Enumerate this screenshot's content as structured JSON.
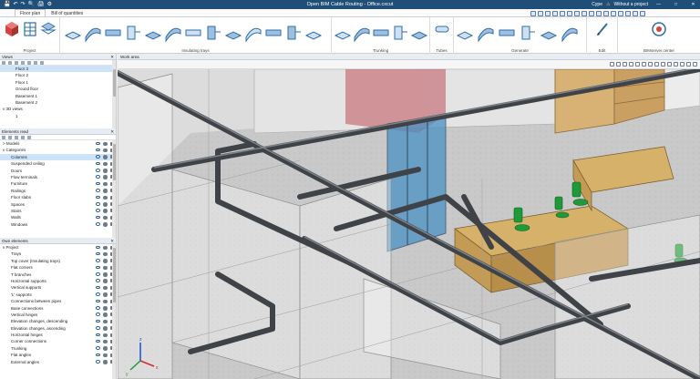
{
  "window": {
    "title": "Open BIM Cable Routing - Office.cxcut",
    "account_label": "Cype",
    "project_status": "Without a project",
    "minimize_glyph": "—",
    "maximize_glyph": "□",
    "close_glyph": "✕"
  },
  "quick_access": [
    "💾",
    "↶",
    "↷",
    "🔍",
    "🖨",
    "⚙"
  ],
  "tabs": [
    {
      "label": "Floor plan",
      "active": true
    },
    {
      "label": "Bill of quantities",
      "active": false
    }
  ],
  "ribbon": {
    "groups": [
      {
        "label": "Project"
      },
      {
        "label": "Insulating trays"
      },
      {
        "label": "Trunking"
      },
      {
        "label": "Tubes"
      },
      {
        "label": "Generate"
      },
      {
        "label": "Edit"
      },
      {
        "label": "BIMserver.center"
      }
    ],
    "icon_colors": {
      "primary": "#2f6ea5",
      "accent": "#d64541",
      "dark": "#3b3b3b"
    }
  },
  "views_panel": {
    "title": "Views",
    "items": [
      {
        "label": "Floor 3",
        "indent": 2,
        "selected": true
      },
      {
        "label": "Floor 2",
        "indent": 2
      },
      {
        "label": "Floor 1",
        "indent": 2
      },
      {
        "label": "Ground floor",
        "indent": 2
      },
      {
        "label": "Basement 1",
        "indent": 2
      },
      {
        "label": "Basement 2",
        "indent": 2
      },
      {
        "label": "3D views",
        "indent": 0,
        "expander": "v"
      },
      {
        "label": "1",
        "indent": 2
      }
    ]
  },
  "elements_read_panel": {
    "title": "Elements read",
    "items": [
      {
        "label": "Models",
        "expander": ">"
      },
      {
        "label": "Categories",
        "expander": "v"
      },
      {
        "label": "Columns",
        "indent": 1,
        "selected": true
      },
      {
        "label": "Suspended ceiling",
        "indent": 1
      },
      {
        "label": "Doors",
        "indent": 1
      },
      {
        "label": "Flow terminals",
        "indent": 1
      },
      {
        "label": "Furniture",
        "indent": 1
      },
      {
        "label": "Railings",
        "indent": 1
      },
      {
        "label": "Floor slabs",
        "indent": 1
      },
      {
        "label": "Spaces",
        "indent": 1
      },
      {
        "label": "Stairs",
        "indent": 1
      },
      {
        "label": "Walls",
        "indent": 1
      },
      {
        "label": "Windows",
        "indent": 1
      }
    ]
  },
  "own_elements_panel": {
    "title": "Own elements",
    "items": [
      {
        "label": "Project",
        "expander": "v"
      },
      {
        "label": "Trays",
        "indent": 1
      },
      {
        "label": "Top cover (Insulating trays)",
        "indent": 1
      },
      {
        "label": "Flat corners",
        "indent": 1
      },
      {
        "label": "T branches",
        "indent": 1
      },
      {
        "label": "Horizontal supports",
        "indent": 1
      },
      {
        "label": "Vertical supports",
        "indent": 1
      },
      {
        "label": "'L' supports",
        "indent": 1
      },
      {
        "label": "Connections between pipes",
        "indent": 1
      },
      {
        "label": "Base connections",
        "indent": 1
      },
      {
        "label": "Vertical hinges",
        "indent": 1
      },
      {
        "label": "Elevation changes, descending",
        "indent": 1
      },
      {
        "label": "Elevation changes, ascending",
        "indent": 1
      },
      {
        "label": "Horizontal hinges",
        "indent": 1
      },
      {
        "label": "Corner connections",
        "indent": 1
      },
      {
        "label": "Trunking",
        "indent": 1
      },
      {
        "label": "Flat angles",
        "indent": 1
      },
      {
        "label": "External angles",
        "indent": 1
      }
    ]
  },
  "work_area": {
    "title": "Work area",
    "axis_labels": {
      "x": "x",
      "y": "y",
      "z": "z"
    }
  }
}
